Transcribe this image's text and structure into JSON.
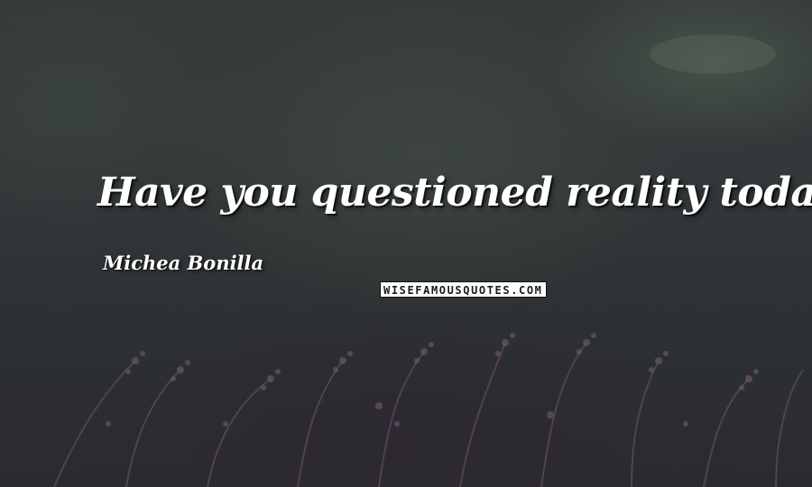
{
  "quote": {
    "text": "Have you questioned reality today"
  },
  "author": {
    "name": "Michea Bonilla"
  },
  "watermark": {
    "text": "WISEFAMOUSQUOTES.COM"
  },
  "background": {
    "description_colors": [
      "#363b3a",
      "#2a2b2f",
      "#6a5470"
    ]
  }
}
